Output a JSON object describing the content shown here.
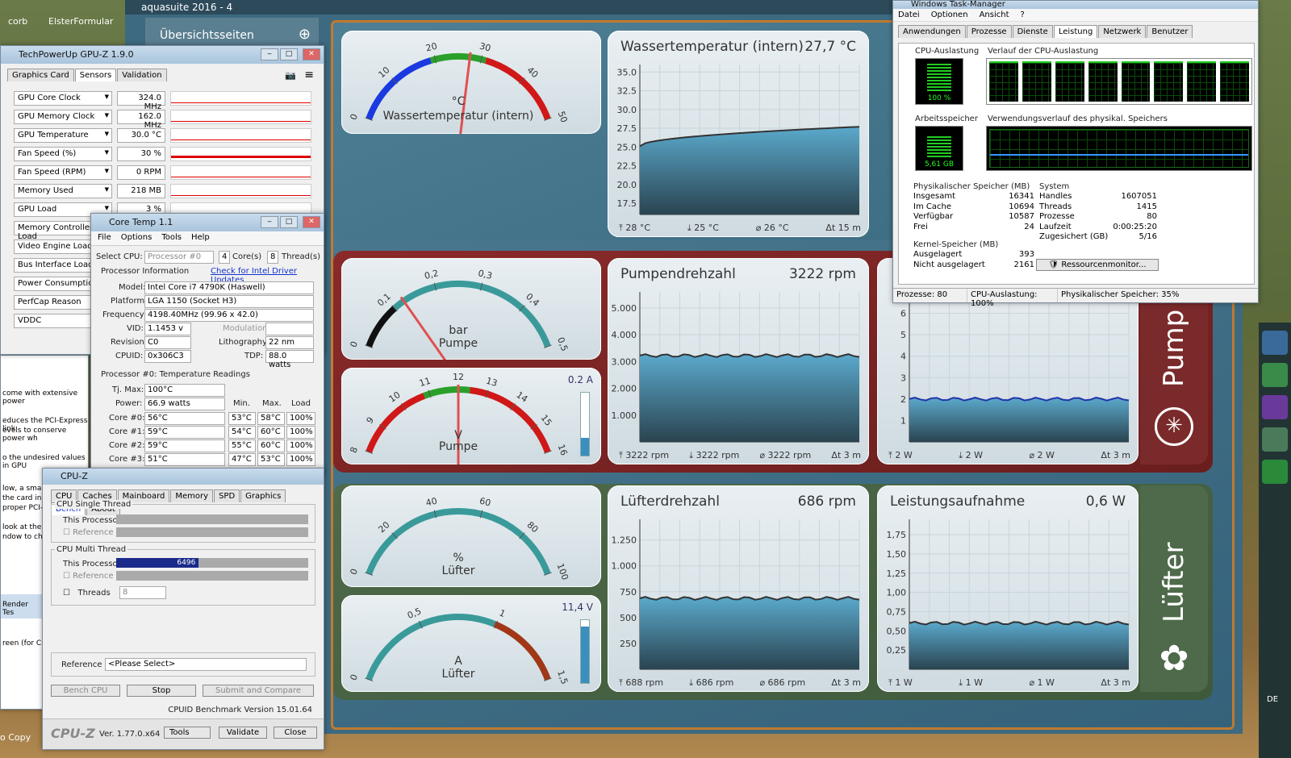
{
  "desktop": {
    "icon1": "corb",
    "icon2": "ElsterFormular",
    "icon3": "o Copy"
  },
  "aquasuite": {
    "title": "aquasuite 2016 - 4",
    "nav": "Übersichtsseiten",
    "gauges": [
      {
        "unit": "°C",
        "label": "Wassertemperatur (intern)",
        "ticks": [
          "0",
          "10",
          "20",
          "30",
          "40",
          "50"
        ]
      },
      {
        "unit": "bar",
        "label": "Pumpe",
        "ticks": [
          "0",
          "0,1",
          "0,2",
          "0,3",
          "0,4",
          "0,5"
        ]
      },
      {
        "unit": "V",
        "label": "Pumpe",
        "ticks": [
          "8",
          "9",
          "10",
          "11",
          "12",
          "13",
          "14",
          "15",
          "16"
        ],
        "side": "0.2 A"
      },
      {
        "unit": "%",
        "label": "Lüfter",
        "ticks": [
          "0",
          "20",
          "40",
          "60",
          "80",
          "100"
        ]
      },
      {
        "unit": "A",
        "label": "Lüfter",
        "ticks": [
          "0",
          "0,5",
          "1",
          "1,5"
        ],
        "side": "11,4 V"
      }
    ],
    "charts": {
      "water": {
        "title": "Wassertemperatur (intern)",
        "value": "27,7 °C",
        "yticks": [
          "35.0",
          "32.5",
          "30.0",
          "27.5",
          "25.0",
          "22.5",
          "20.0",
          "17.5"
        ],
        "foot": [
          "⤒ 28 °C",
          "⤓ 25 °C",
          "⌀ 26 °C",
          "Δt 15 m"
        ]
      },
      "pump": {
        "title": "Pumpendrehzahl",
        "value": "3222 rpm",
        "yticks": [
          "5.000",
          "4.000",
          "3.000",
          "2.000",
          "1.000"
        ],
        "foot": [
          "⤒ 3222 rpm",
          "⤓ 3222 rpm",
          "⌀ 3222 rpm",
          "Δt 3 m"
        ]
      },
      "pumppow": {
        "yticks": [
          "6",
          "5",
          "4",
          "3",
          "2",
          "1"
        ],
        "foot": [
          "⤒ 2 W",
          "⤓ 2 W",
          "⌀ 2 W",
          "Δt 3 m"
        ]
      },
      "fan": {
        "title": "Lüfterdrehzahl",
        "value": "686 rpm",
        "yticks": [
          "1.250",
          "1.000",
          "750",
          "500",
          "250"
        ],
        "foot": [
          "⤒ 688 rpm",
          "⤓ 686 rpm",
          "⌀ 686 rpm",
          "Δt 3 m"
        ]
      },
      "fanpow": {
        "title": "Leistungsaufnahme",
        "value": "0,6 W",
        "yticks": [
          "1,75",
          "1,50",
          "1,25",
          "1,00",
          "0,75",
          "0,50",
          "0,25"
        ],
        "foot": [
          "⤒ 1 W",
          "⤓ 1 W",
          "⌀ 1 W",
          "Δt 3 m"
        ]
      }
    },
    "side_pump": "Pump",
    "side_fan": "Lüfter"
  },
  "gpuz": {
    "title": "TechPowerUp GPU-Z 1.9.0",
    "tabs": [
      "Graphics Card",
      "Sensors",
      "Validation"
    ],
    "rows": [
      [
        "GPU Core Clock",
        "324.0 MHz"
      ],
      [
        "GPU Memory Clock",
        "162.0 MHz"
      ],
      [
        "GPU Temperature",
        "30.0 °C"
      ],
      [
        "Fan Speed (%)",
        "30 %"
      ],
      [
        "Fan Speed (RPM)",
        "0 RPM"
      ],
      [
        "Memory Used",
        "218 MB"
      ],
      [
        "GPU Load",
        "3 %"
      ],
      [
        "Memory Controller Load",
        ""
      ],
      [
        "Video Engine Load",
        ""
      ],
      [
        "Bus Interface Load",
        ""
      ],
      [
        "Power Consumption",
        ""
      ],
      [
        "PerfCap Reason",
        ""
      ],
      [
        "VDDC",
        ""
      ]
    ]
  },
  "coretemp": {
    "title": "Core Temp 1.1",
    "menu": [
      "File",
      "Options",
      "Tools",
      "Help"
    ],
    "select_cpu": "Select CPU:",
    "processor": "Processor #0",
    "cores_val": "4",
    "cores": "Core(s)",
    "threads_val": "8",
    "threads": "Thread(s)",
    "pinfo": "Processor Information",
    "link": "Check for Intel Driver Updates",
    "model_l": "Model:",
    "model": "Intel Core i7 4790K (Haswell)",
    "platform_l": "Platform:",
    "platform": "LGA 1150 (Socket H3)",
    "freq_l": "Frequency:",
    "freq": "4198.40MHz (99.96 x 42.0)",
    "vid_l": "VID:",
    "vid": "1.1453 v",
    "mod_l": "Modulation:",
    "rev_l": "Revision:",
    "rev": "C0",
    "lith_l": "Lithography:",
    "lith": "22 nm",
    "cpuid_l": "CPUID:",
    "cpuid": "0x306C3",
    "tdp_l": "TDP:",
    "tdp": "88.0 watts",
    "temps_h": "Processor #0: Temperature Readings",
    "tj_l": "Tj. Max:",
    "tj": "100°C",
    "pow_l": "Power:",
    "pow": "66.9 watts",
    "h_min": "Min.",
    "h_max": "Max.",
    "h_load": "Load",
    "cores_rows": [
      [
        "Core #0:",
        "56°C",
        "53°C",
        "58°C",
        "100%"
      ],
      [
        "Core #1:",
        "59°C",
        "54°C",
        "60°C",
        "100%"
      ],
      [
        "Core #2:",
        "59°C",
        "55°C",
        "60°C",
        "100%"
      ],
      [
        "Core #3:",
        "51°C",
        "47°C",
        "53°C",
        "100%"
      ]
    ]
  },
  "cpuz": {
    "title": "CPU-Z",
    "tabs": [
      "CPU",
      "Caches",
      "Mainboard",
      "Memory",
      "SPD",
      "Graphics",
      "Bench",
      "About"
    ],
    "single": "CPU Single Thread",
    "this": "This Processor",
    "ref": "Reference",
    "multi": "CPU Multi Thread",
    "score": "6496",
    "threads": "Threads",
    "threads_val": "8",
    "reference": "Reference",
    "please": "<Please Select>",
    "b1": "Bench CPU",
    "b2": "Stop",
    "b3": "Submit and Compare",
    "bench_ver": "CPUID Benchmark Version 15.01.64",
    "logo": "CPU-Z",
    "ver": "Ver. 1.77.0.x64",
    "tools": "Tools",
    "validate": "Validate",
    "close": "Close"
  },
  "leftwin": {
    "lines": [
      "come with extensive power",
      "educes the PCI-Express link",
      "evels to conserve power wh",
      "o the undesired values in GPU",
      "low, a small",
      "the card in",
      "proper PCI-E",
      "look at the li",
      "ndow to cha",
      "Render Tes",
      "reen (for Cro"
    ]
  },
  "taskmgr": {
    "title": "Windows Task-Manager",
    "menu": [
      "Datei",
      "Optionen",
      "Ansicht",
      "?"
    ],
    "tabs": [
      "Anwendungen",
      "Prozesse",
      "Dienste",
      "Leistung",
      "Netzwerk",
      "Benutzer"
    ],
    "cpu_l": "CPU-Auslastung",
    "cpu_v": "100 %",
    "hist_l": "Verlauf der CPU-Auslastung",
    "mem_l": "Arbeitsspeicher",
    "mem_v": "5,61 GB",
    "memhist_l": "Verwendungsverlauf des physikal. Speichers",
    "phys_h": "Physikalischer Speicher (MB)",
    "phys": [
      [
        "Insgesamt",
        "16341"
      ],
      [
        "Im Cache",
        "10694"
      ],
      [
        "Verfügbar",
        "10587"
      ],
      [
        "Frei",
        "24"
      ]
    ],
    "sys_h": "System",
    "sys": [
      [
        "Handles",
        "1607051"
      ],
      [
        "Threads",
        "1415"
      ],
      [
        "Prozesse",
        "80"
      ],
      [
        "Laufzeit",
        "0:00:25:20"
      ],
      [
        "Zugesichert (GB)",
        "5/16"
      ]
    ],
    "kern_h": "Kernel-Speicher (MB)",
    "kern": [
      [
        "Ausgelagert",
        "393"
      ],
      [
        "Nicht ausgelagert",
        "2161"
      ]
    ],
    "resmon": "Ressourcenmonitor...",
    "status": [
      "Prozesse: 80",
      "CPU-Auslastung: 100%",
      "Physikalischer Speicher: 35%"
    ]
  },
  "tray": {
    "lang": "DE"
  }
}
